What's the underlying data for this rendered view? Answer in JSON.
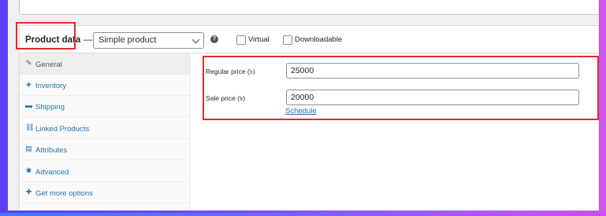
{
  "metabox": {
    "title": "Product data",
    "title_dash": "—",
    "product_type": {
      "selected": "Simple product"
    },
    "help_icon": "?",
    "virtual_label": "Virtual",
    "downloadable_label": "Downloadable"
  },
  "tabs": [
    {
      "label": "General",
      "icon": "wrench-icon",
      "glyph": "✎",
      "active": true
    },
    {
      "label": "Inventory",
      "icon": "tag-icon",
      "glyph": "◈",
      "active": false
    },
    {
      "label": "Shipping",
      "icon": "truck-icon",
      "glyph": "▬",
      "active": false
    },
    {
      "label": "Linked Products",
      "icon": "link-icon",
      "glyph": "⛓",
      "active": false
    },
    {
      "label": "Attributes",
      "icon": "list-icon",
      "glyph": "▤",
      "active": false
    },
    {
      "label": "Advanced",
      "icon": "gear-icon",
      "glyph": "✱",
      "active": false
    },
    {
      "label": "Get more options",
      "icon": "plugin-icon",
      "glyph": "✚",
      "active": false
    }
  ],
  "general": {
    "regular_price_label": "Regular price (৳)",
    "regular_price_value": "25000",
    "sale_price_label": "Sale price (৳)",
    "sale_price_value": "20000",
    "schedule_link": "Schedule"
  },
  "colors": {
    "highlight": "#e22a2a",
    "link": "#2271b1",
    "frame_start": "#5b3df5",
    "frame_end": "#cc55ee"
  }
}
